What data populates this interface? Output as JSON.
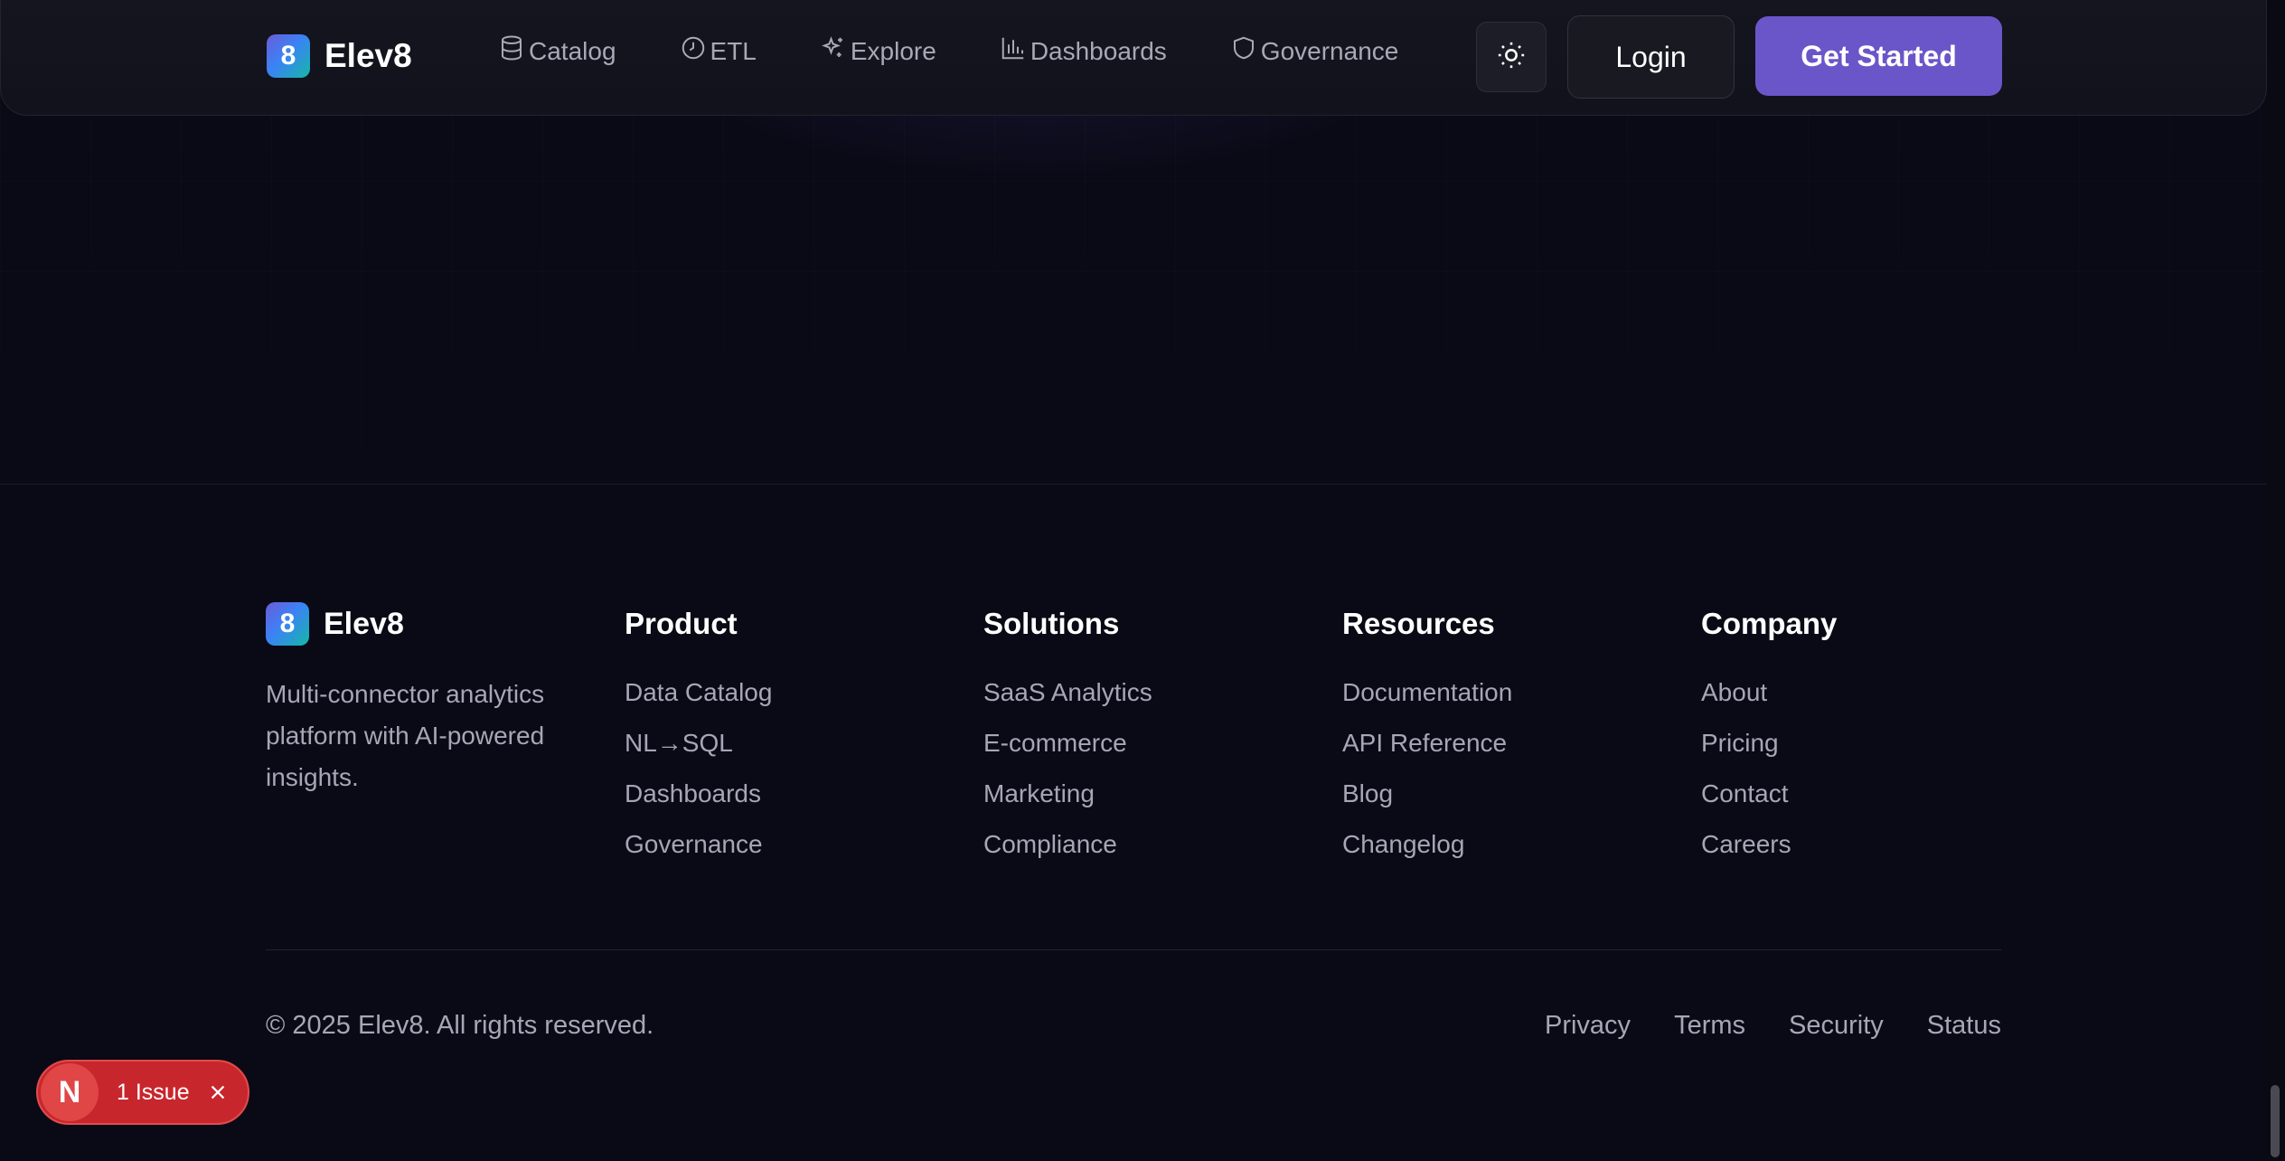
{
  "brand": {
    "name": "Elev8",
    "mark": "8"
  },
  "nav": {
    "links": [
      {
        "label": "Catalog",
        "icon": "database-icon"
      },
      {
        "label": "ETL",
        "icon": "clock-icon"
      },
      {
        "label": "Explore",
        "icon": "sparkles-icon"
      },
      {
        "label": "Dashboards",
        "icon": "bar-chart-icon"
      },
      {
        "label": "Governance",
        "icon": "shield-icon"
      }
    ],
    "theme_toggle_icon": "sun-icon",
    "login_label": "Login",
    "get_started_label": "Get Started"
  },
  "footer": {
    "tagline": "Multi-connector analytics platform with AI-powered insights.",
    "columns": [
      {
        "title": "Product",
        "links": [
          "Data Catalog",
          "NL→SQL",
          "Dashboards",
          "Governance"
        ]
      },
      {
        "title": "Solutions",
        "links": [
          "SaaS Analytics",
          "E-commerce",
          "Marketing",
          "Compliance"
        ]
      },
      {
        "title": "Resources",
        "links": [
          "Documentation",
          "API Reference",
          "Blog",
          "Changelog"
        ]
      },
      {
        "title": "Company",
        "links": [
          "About",
          "Pricing",
          "Contact",
          "Careers"
        ]
      }
    ],
    "copyright": "© 2025 Elev8. All rights reserved.",
    "legal_links": [
      "Privacy",
      "Terms",
      "Security",
      "Status"
    ]
  },
  "issue_indicator": {
    "badge": "N",
    "label": "1 Issue"
  },
  "colors": {
    "background": "#0a0a16",
    "accent": "#6b56c9",
    "issue_red": "#c8262d"
  }
}
